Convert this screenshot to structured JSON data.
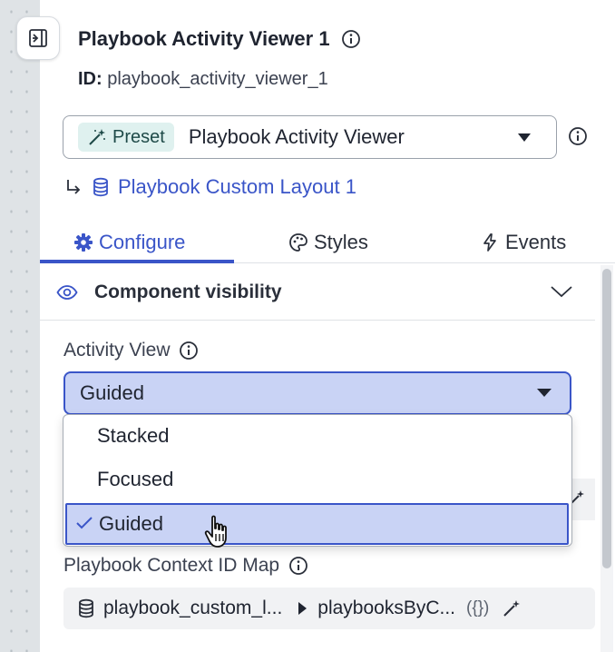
{
  "panel": {
    "title": "Playbook Activity Viewer 1",
    "id_label": "ID:",
    "id_value": "playbook_activity_viewer_1"
  },
  "preset": {
    "tag_label": "Preset",
    "selected": "Playbook Activity Viewer"
  },
  "layout_link": {
    "label": "Playbook Custom Layout 1"
  },
  "tabs": [
    {
      "label": "Configure",
      "icon": "gear-icon",
      "active": true
    },
    {
      "label": "Styles",
      "icon": "palette-icon",
      "active": false
    },
    {
      "label": "Events",
      "icon": "lightning-icon",
      "active": false
    }
  ],
  "section": {
    "title": "Component visibility"
  },
  "activity_view": {
    "label": "Activity View",
    "selected": "Guided",
    "options": [
      "Stacked",
      "Focused",
      "Guided"
    ]
  },
  "context_map": {
    "label": "Playbook Context ID Map",
    "source": "playbook_custom_l...",
    "path": "playbooksByC...",
    "json_badge": "({})"
  },
  "colors": {
    "accent": "#3a55c8",
    "selected_bg": "#c9d3f5",
    "preset_tag_bg": "#dff1ef"
  }
}
